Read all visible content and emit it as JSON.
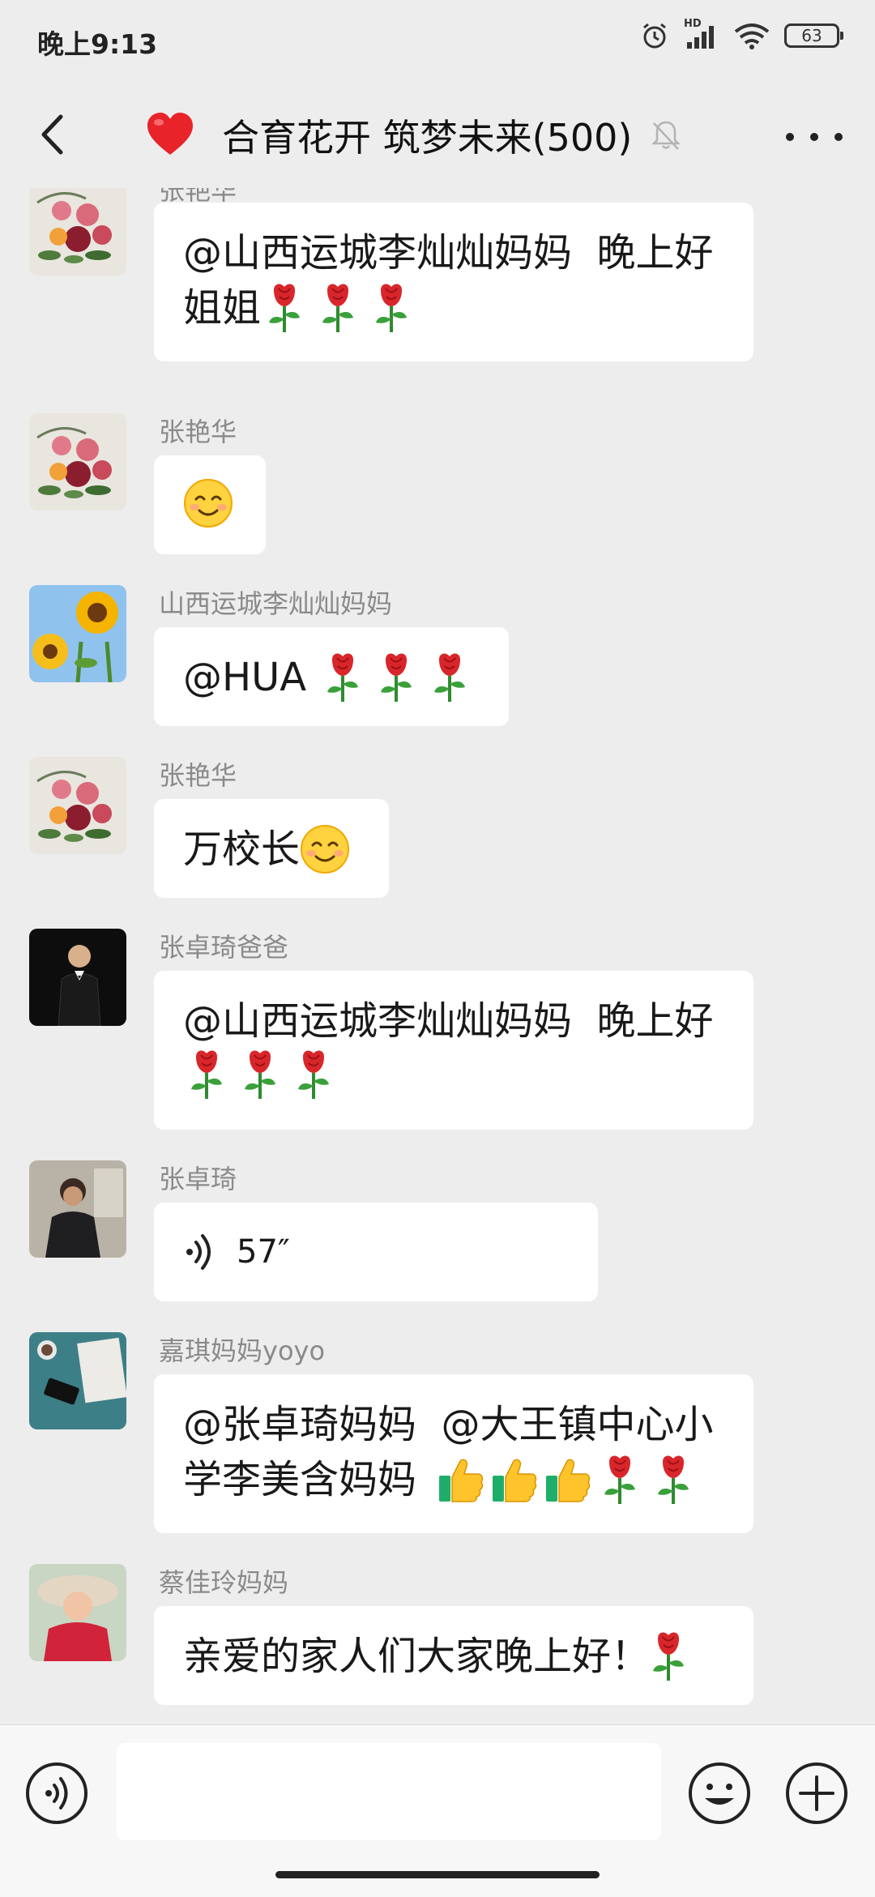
{
  "status_bar": {
    "time": "晚上9:13",
    "network": "HD",
    "battery": "63"
  },
  "header": {
    "back_icon": "chevron-left-icon",
    "title_emoji": "red-heart-icon",
    "title": "合育花开 筑梦未来(500)",
    "muted_icon": "bell-off-icon",
    "more_icon": "more-dots-icon"
  },
  "messages": [
    {
      "sender": "张艳华",
      "avatar": "peony-painting",
      "line1": "@山西运城李灿灿妈妈  晚上好",
      "line2": "姐姐"
    },
    {
      "sender": "张艳华",
      "avatar": "peony-painting"
    },
    {
      "sender": "山西运城李灿灿妈妈",
      "avatar": "sunflower",
      "text": "@HUA"
    },
    {
      "sender": "张艳华",
      "avatar": "peony-painting",
      "text": "万校长"
    },
    {
      "sender": "张卓琦爸爸",
      "avatar": "man-in-suit",
      "line1": "@山西运城李灿灿妈妈  晚上好"
    },
    {
      "sender": "张卓琦",
      "avatar": "person-photo",
      "voice_duration": "57″"
    },
    {
      "sender": "嘉琪妈妈yoyo",
      "avatar": "desk-photo",
      "line1": "@张卓琦妈妈  @大王镇中心小",
      "line2": "学李美含妈妈"
    },
    {
      "sender": "蔡佳玲妈妈",
      "avatar": "girl-in-hat",
      "text": "亲爱的家人们大家晚上好！"
    }
  ],
  "input_bar": {
    "voice_icon": "voice-input-icon",
    "placeholder": "",
    "emoji_icon": "emoji-face-icon",
    "plus_icon": "plus-circle-icon"
  }
}
